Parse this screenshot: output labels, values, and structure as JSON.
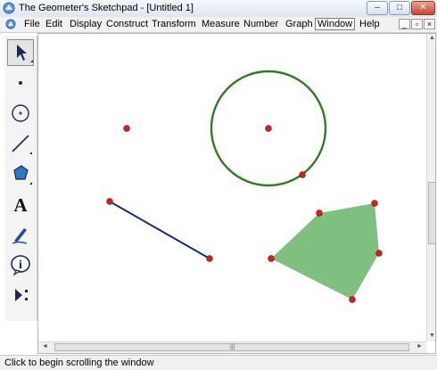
{
  "window": {
    "title": "The Geometer's Sketchpad - [Untitled 1]",
    "minimize_glyph": "–",
    "maximize_glyph": "□",
    "close_glyph": "✕"
  },
  "menu": {
    "items": [
      "File",
      "Edit",
      "Display",
      "Construct",
      "Transform",
      "Measure",
      "Number",
      "Graph",
      "Window",
      "Help"
    ],
    "mdi_minimize": "_",
    "mdi_restore": "▫",
    "mdi_close": "×"
  },
  "toolbox": {
    "tools": [
      {
        "name": "arrow-tool",
        "icon": "arrow-icon",
        "selected": true
      },
      {
        "name": "point-tool",
        "icon": "point-icon"
      },
      {
        "name": "compass-tool",
        "icon": "compass-icon"
      },
      {
        "name": "straightedge-tool",
        "icon": "segment-icon"
      },
      {
        "name": "polygon-tool",
        "icon": "polygon-icon"
      },
      {
        "name": "text-tool",
        "icon": "text-icon",
        "label": "A"
      },
      {
        "name": "marker-tool",
        "icon": "marker-icon"
      },
      {
        "name": "information-tool",
        "icon": "info-icon",
        "label": "i"
      },
      {
        "name": "custom-tool",
        "icon": "custom-tools-icon"
      }
    ]
  },
  "sketch": {
    "colors": {
      "point": "#d32020",
      "circle": "#2e7d22",
      "segment": "#1a2a7a",
      "polygon_fill": "#7fbf7f"
    }
  },
  "scrollbars": {
    "up_arrow": "▲",
    "down_arrow": "▼",
    "left_arrow": "◄",
    "right_arrow": "►",
    "grip": "|||"
  },
  "status": {
    "text": "Click to begin scrolling the window"
  }
}
